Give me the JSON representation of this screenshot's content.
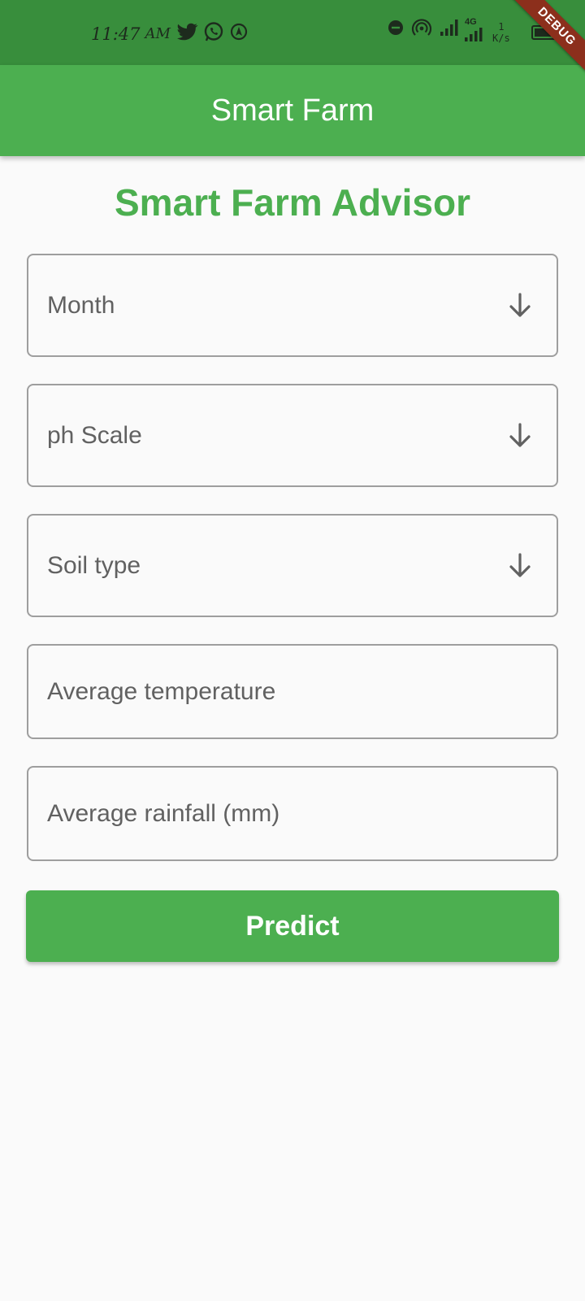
{
  "status_bar": {
    "time": "11:47",
    "ampm": "AM",
    "network_label": "4G",
    "speed_value": "1",
    "speed_unit": "K/s"
  },
  "debug_banner": "DEBUG",
  "app_bar": {
    "title": "Smart Farm"
  },
  "heading": "Smart Farm Advisor",
  "form": {
    "dropdowns": [
      {
        "label": "Month",
        "icon": "arrow-down-icon"
      },
      {
        "label": "ph Scale",
        "icon": "arrow-down-icon"
      },
      {
        "label": "Soil type",
        "icon": "arrow-down-icon"
      }
    ],
    "text_fields": [
      {
        "placeholder": "Average temperature"
      },
      {
        "placeholder": "Average rainfall (mm)"
      }
    ],
    "submit_label": "Predict"
  },
  "colors": {
    "primary": "#4caf50",
    "status_bar": "#388e3c",
    "background": "#fafafa",
    "field_border": "#9e9e9e",
    "label_text": "#616161"
  }
}
